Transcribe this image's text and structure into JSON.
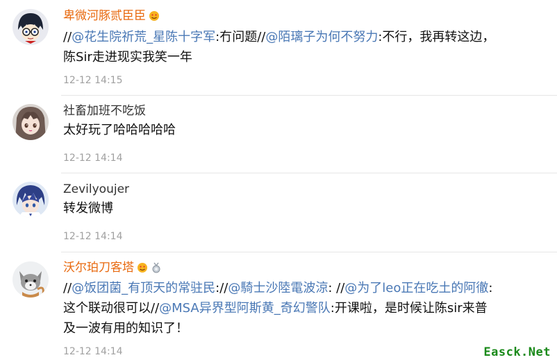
{
  "comments": [
    {
      "username": "卑微河豚贰臣臣",
      "text_lines": [
        [
          {
            "t": "//",
            "m": false
          },
          {
            "t": "@花生院祈荒_星陈十字军",
            "m": true
          },
          {
            "t": ":冇问题//",
            "m": false
          },
          {
            "t": "@陌璃子为何不努力",
            "m": true
          },
          {
            "t": ":不行，我再转这边，",
            "m": false
          }
        ],
        [
          {
            "t": "陈Sir走进现实我笑一年",
            "m": false
          }
        ]
      ],
      "time": "12-12 14:15",
      "badges": [
        "emoji-badge-icon"
      ]
    },
    {
      "username": "社畜加班不吃饭",
      "text_lines": [
        [
          {
            "t": "太好玩了哈哈哈哈哈",
            "m": false
          }
        ]
      ],
      "time": "12-12 14:14",
      "badges": []
    },
    {
      "username": "Zevilyoujer",
      "text_lines": [
        [
          {
            "t": "转发微博",
            "m": false
          }
        ]
      ],
      "time": "12-12 14:14",
      "badges": []
    },
    {
      "username": "沃尔珀刀客塔",
      "text_lines": [
        [
          {
            "t": "//",
            "m": false
          },
          {
            "t": "@饭团菌_有顶天的常驻民",
            "m": true
          },
          {
            "t": "://",
            "m": false
          },
          {
            "t": "@騎士沙陸電波涼",
            "m": true
          },
          {
            "t": ": //",
            "m": false
          },
          {
            "t": "@为了leo正在吃土的阿徹",
            "m": true
          },
          {
            "t": ":",
            "m": false
          }
        ],
        [
          {
            "t": "这个联动很可以//",
            "m": false
          },
          {
            "t": "@MSA异界型阿斯黄_奇幻警队",
            "m": true
          },
          {
            "t": ":开课啦，是时候让陈sir来普",
            "m": false
          }
        ],
        [
          {
            "t": "及一波有用的知识了！",
            "m": false
          }
        ]
      ],
      "time": "12-12 14:14",
      "badges": [
        "emoji-badge-icon",
        "medal-badge-icon"
      ]
    }
  ],
  "watermark": "Easck.Net",
  "colors": {
    "vip_name": "#e86a10",
    "mention": "#4a78b5",
    "time": "#a0a0a0",
    "watermark": "#1a8a1a"
  }
}
